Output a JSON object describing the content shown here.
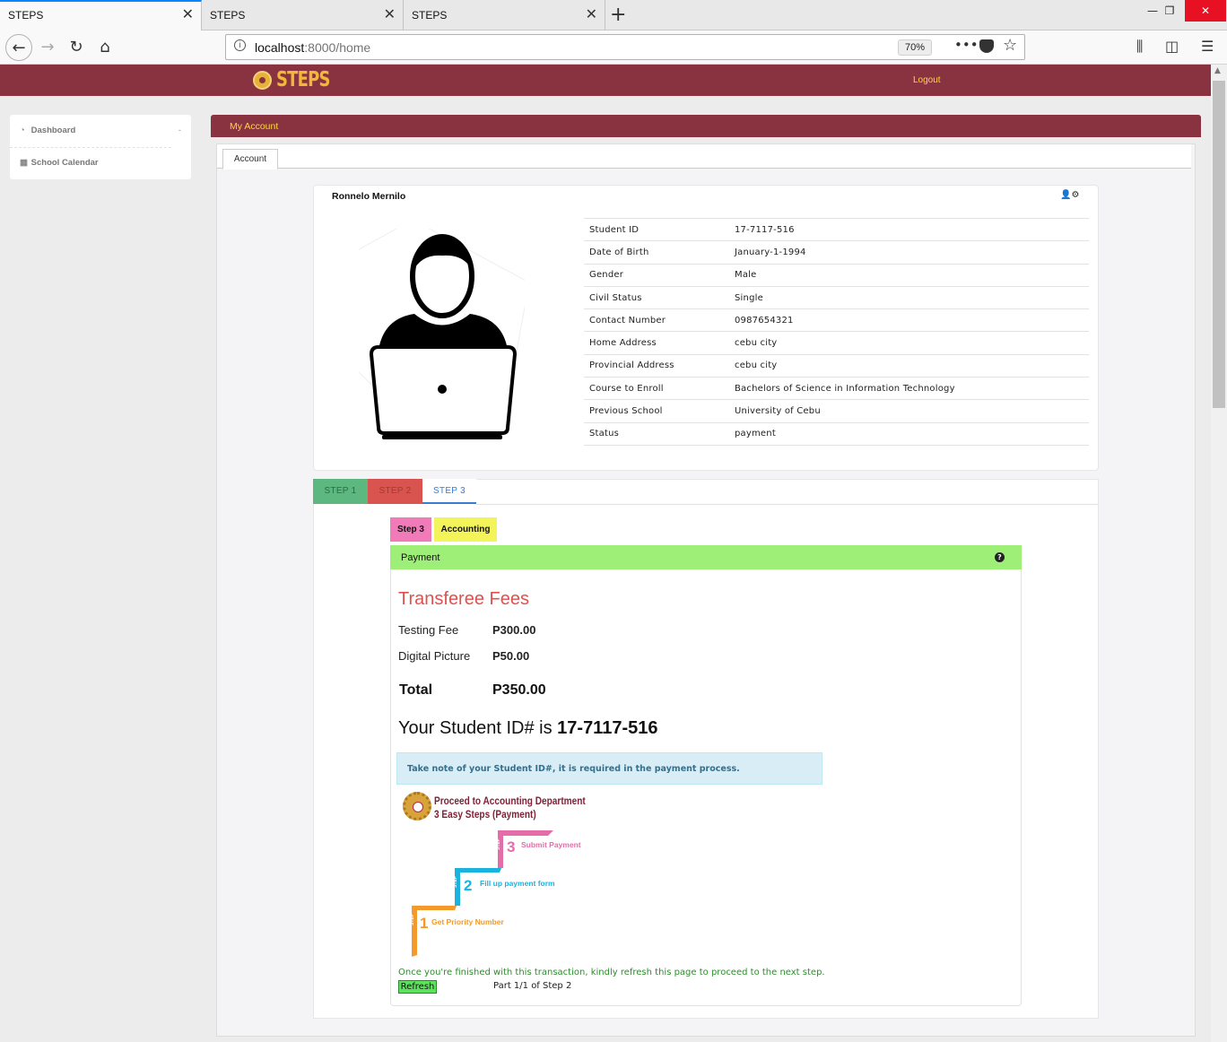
{
  "browser": {
    "tabs": [
      {
        "title": "STEPS"
      },
      {
        "title": "STEPS"
      },
      {
        "title": "STEPS"
      }
    ],
    "url_host": "localhost",
    "url_rest": ":8000/home",
    "zoom": "70%"
  },
  "app": {
    "logo_text": "STEPS",
    "logout": "Logout"
  },
  "sidebar": {
    "items": [
      {
        "label": "Dashboard",
        "icon": "dashboard-icon"
      },
      {
        "label": "School Calendar",
        "icon": "calendar-icon"
      }
    ]
  },
  "main": {
    "header": "My Account",
    "tab": "Account"
  },
  "profile": {
    "name": "Ronnelo Mernilo",
    "fields": [
      {
        "key": "Student ID",
        "value": "17-7117-516"
      },
      {
        "key": "Date of Birth",
        "value": "January-1-1994"
      },
      {
        "key": "Gender",
        "value": "Male"
      },
      {
        "key": "Civil Status",
        "value": "Single"
      },
      {
        "key": "Contact Number",
        "value": "0987654321"
      },
      {
        "key": "Home Address",
        "value": "cebu city"
      },
      {
        "key": "Provincial Address",
        "value": "cebu city"
      },
      {
        "key": "Course to Enroll",
        "value": "Bachelors of Science in Information Technology"
      },
      {
        "key": "Previous School",
        "value": "University of Cebu"
      },
      {
        "key": "Status",
        "value": "payment"
      }
    ]
  },
  "steps": {
    "tabs": [
      "STEP 1",
      "STEP 2",
      "STEP 3"
    ],
    "badge_step": "Step 3",
    "badge_dept": "Accounting",
    "panel_title": "Payment",
    "fees_title": "Transferee Fees",
    "fees": [
      {
        "label": "Testing Fee",
        "amount": "P300.00"
      },
      {
        "label": "Digital Picture",
        "amount": "P50.00"
      }
    ],
    "total_label": "Total",
    "total_amount": "P350.00",
    "student_id_prefix": "Your Student ID# is",
    "student_id": "17-7117-516",
    "note": "Take note of your Student ID#, it is required in the payment process.",
    "graphic_title_1": "Proceed to Accounting Department",
    "graphic_title_2": "3 Easy Steps (Payment)",
    "graphic_steps": [
      {
        "num": "1",
        "word": "STEP",
        "label": "Get Priority Number",
        "color": "#f39a2a"
      },
      {
        "num": "2",
        "word": "STEP",
        "label": "Fill up payment form",
        "color": "#1ab3e0"
      },
      {
        "num": "3",
        "word": "STEP",
        "label": "Submit Payment",
        "color": "#e46da9"
      }
    ],
    "finish_msg": "Once you're finished with this transaction, kindly refresh this page to proceed to the next step.",
    "refresh": "Refresh",
    "part": "Part 1/1 of Step 2"
  },
  "colors": {
    "brand": "#8a3340",
    "accent_yellow": "#ffd43b",
    "panel_green": "#9def78",
    "fees_red": "#e0504f"
  }
}
